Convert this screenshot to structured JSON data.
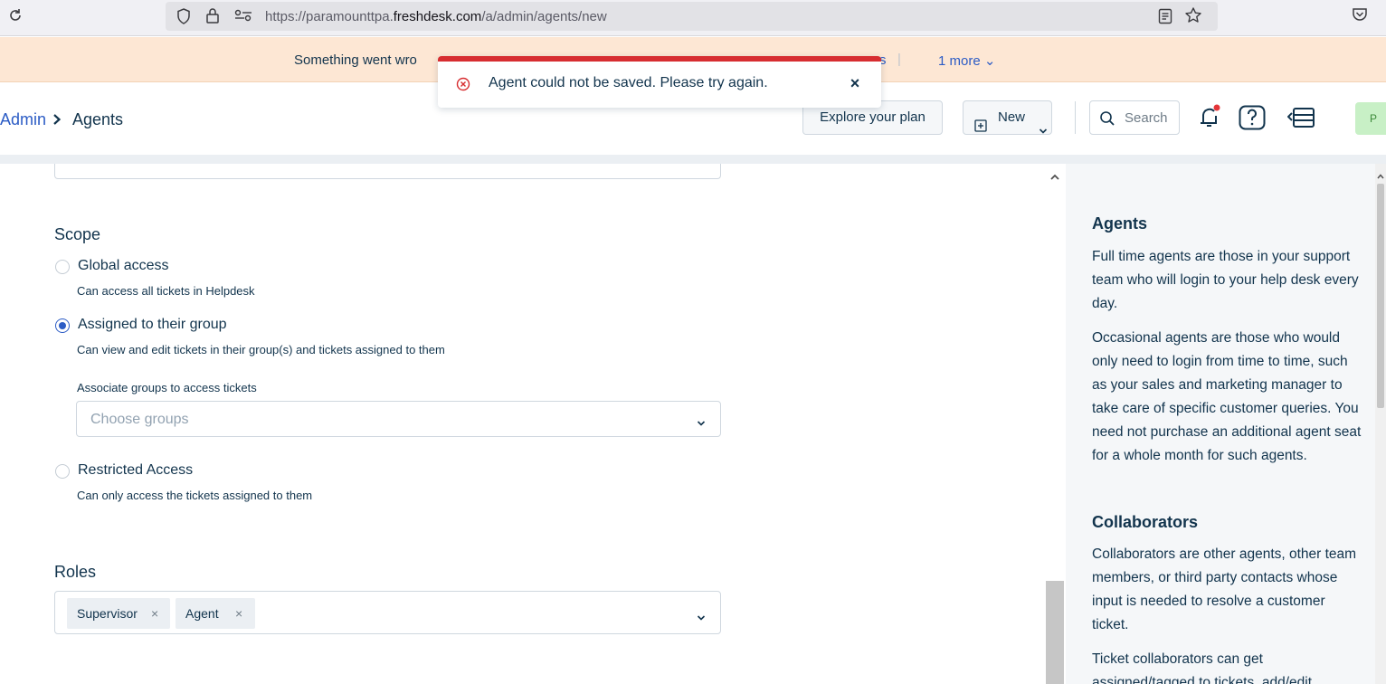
{
  "browser": {
    "url_prefix": "https://paramounttpa.",
    "url_domain": "freshdesk.com",
    "url_path": "/a/admin/agents/new"
  },
  "banner": {
    "text": "Something went wro",
    "tail": "s",
    "separator": "|",
    "more": "1 more ⌄"
  },
  "toast": {
    "message": "Agent could not be saved. Please try again.",
    "close": "×",
    "accent_color": "#d72d30"
  },
  "header": {
    "breadcrumb_root": "Admin",
    "breadcrumb_current": "Agents",
    "explore_label": "Explore your plan",
    "new_label": "New",
    "search_placeholder": "Search",
    "avatar_initial": "P"
  },
  "scope": {
    "title": "Scope",
    "options": [
      {
        "label": "Global access",
        "desc": "Can access all tickets in Helpdesk",
        "checked": false
      },
      {
        "label": "Assigned to their group",
        "desc": "Can view and edit tickets in their group(s) and tickets assigned to them",
        "checked": true
      },
      {
        "label": "Restricted Access",
        "desc": "Can only access the tickets assigned to them",
        "checked": false
      }
    ],
    "groups_label": "Associate groups to access tickets",
    "groups_placeholder": "Choose groups"
  },
  "roles": {
    "title": "Roles",
    "tags": [
      "Supervisor",
      "Agent"
    ],
    "tag_remove": "×"
  },
  "sidebar": {
    "agents_title": "Agents",
    "agents_p1": "Full time agents are those in your support team who will login to your help desk every day.",
    "agents_p2": "Occasional agents are those who would only need to login from time to time, such as your sales and marketing manager to take care of specific customer queries. You need not purchase an additional agent seat for a whole month for such agents.",
    "collab_title": "Collaborators",
    "collab_p1": "Collaborators are other agents, other team members, or third party contacts whose input is needed to resolve a customer ticket.",
    "collab_p2": "Ticket collaborators can get assigned/tagged to tickets, add/edit"
  },
  "colors": {
    "link": "#2c5cc5",
    "text": "#12344d",
    "banner_bg": "#fde7d4",
    "sidebar_bg": "#f5f7f9"
  },
  "icons": [
    "reload-icon",
    "shield-icon",
    "lock-icon",
    "permissions-icon",
    "reader-icon",
    "star-icon",
    "pocket-icon",
    "error-icon",
    "chevron-right-icon",
    "plus-box-icon",
    "chevron-down-icon",
    "search-icon",
    "bell-icon",
    "help-icon",
    "apps-icon"
  ]
}
